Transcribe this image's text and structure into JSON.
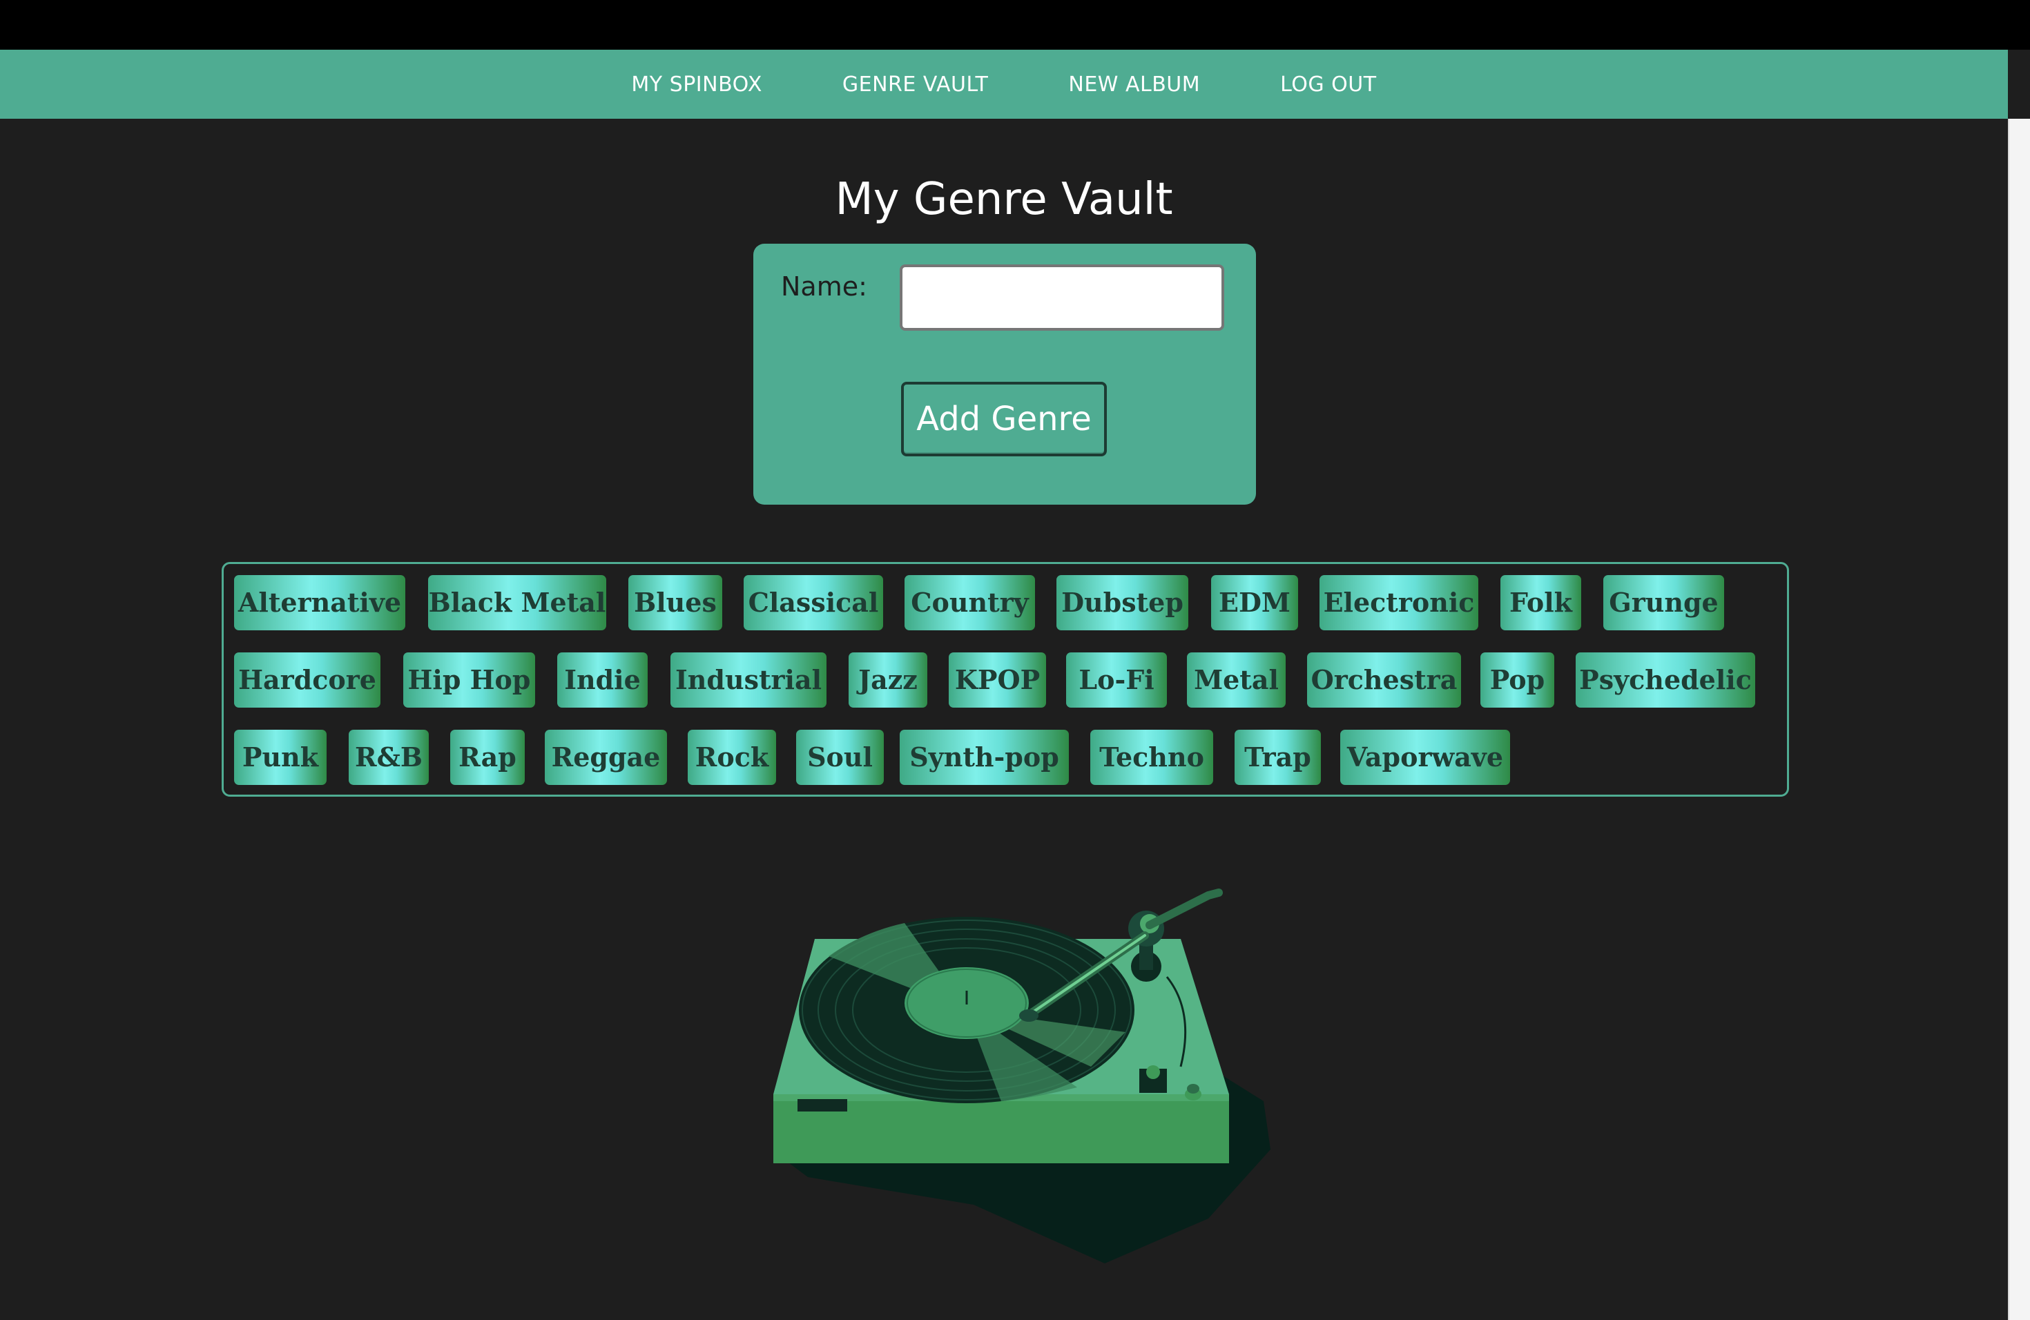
{
  "nav": {
    "links": [
      "MY SPINBOX",
      "GENRE VAULT",
      "NEW ALBUM",
      "LOG OUT"
    ]
  },
  "page": {
    "title": "My Genre Vault"
  },
  "form": {
    "name_label": "Name:",
    "name_value": "",
    "add_button_label": "Add Genre"
  },
  "genres": [
    "Alternative",
    "Black Metal",
    "Blues",
    "Classical",
    "Country",
    "Dubstep",
    "EDM",
    "Electronic",
    "Folk",
    "Grunge",
    "Hardcore",
    "Hip Hop",
    "Indie",
    "Industrial",
    "Jazz",
    "KPOP",
    "Lo-Fi",
    "Metal",
    "Orchestra",
    "Pop",
    "Psychedelic",
    "Punk",
    "R&B",
    "Rap",
    "Reggae",
    "Rock",
    "Soul",
    "Synth-pop",
    "Techno",
    "Trap",
    "Vaporwave"
  ],
  "colors": {
    "accent": "#4fac92",
    "background": "#1e1e1e",
    "chip_text": "#1f3d34"
  },
  "icons": {
    "illustration": "turntable-illustration"
  }
}
